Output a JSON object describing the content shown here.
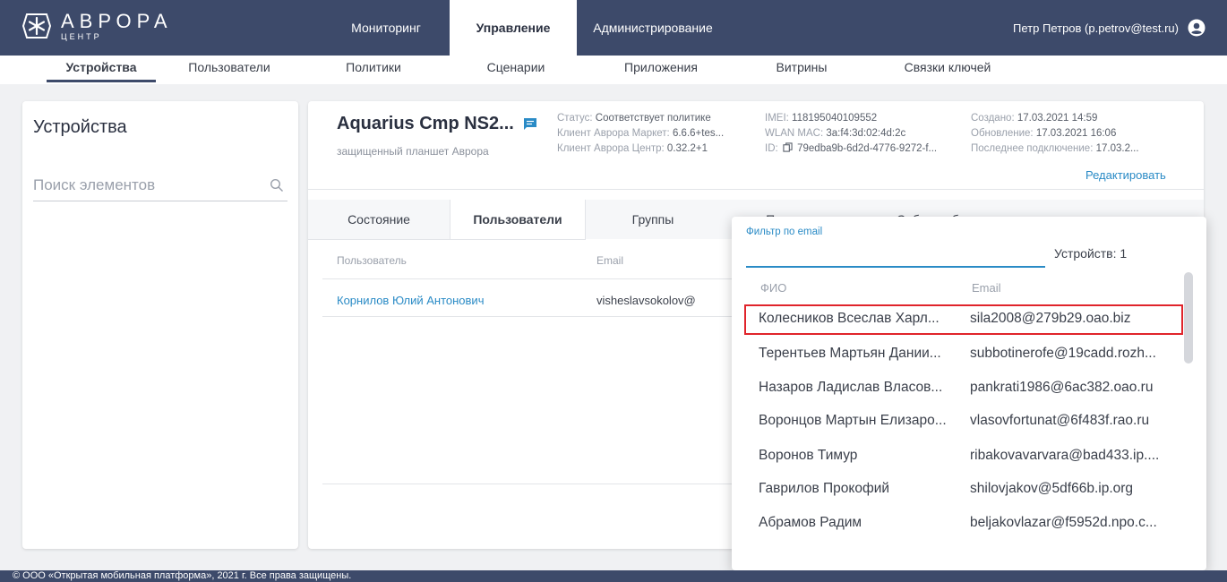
{
  "app": {
    "logo_title": "АВРОРА",
    "logo_sub": "ЦЕНТР"
  },
  "main_nav": [
    "Мониторинг",
    "Управление",
    "Администрирование"
  ],
  "user": {
    "label": "Петр Петров (p.petrov@test.ru)"
  },
  "sub_nav": [
    "Устройства",
    "Пользователи",
    "Политики",
    "Сценарии",
    "Приложения",
    "Витрины",
    "Связки ключей"
  ],
  "left_panel": {
    "title": "Устройства",
    "search_placeholder": "Поиск элементов"
  },
  "device": {
    "name": "Aquarius Cmp NS2...",
    "subtitle": "защищенный планшет Аврора",
    "status_label": "Статус:",
    "status_value": "Соответствует политике",
    "market_label": "Клиент Аврора Маркет:",
    "market_value": "6.6.6+tes...",
    "center_label": "Клиент Аврора Центр:",
    "center_value": "0.32.2+1",
    "imei_label": "IMEI:",
    "imei_value": "118195040109552",
    "wlan_label": "WLAN MAC:",
    "wlan_value": "3a:f4:3d:02:4d:2c",
    "id_label": "ID:",
    "id_value": "79edba9b-6d2d-4776-9272-f...",
    "created_label": "Создано:",
    "created_value": "17.03.2021 14:59",
    "updated_label": "Обновление:",
    "updated_value": "17.03.2021 16:06",
    "last_label": "Последнее подключение:",
    "last_value": "17.03.2...",
    "edit": "Редактировать"
  },
  "tabs": [
    "Состояние",
    "Пользователи",
    "Группы",
    "Политики",
    "События безопасности"
  ],
  "users_table": {
    "col_user": "Пользователь",
    "col_email": "Email",
    "rows": [
      {
        "name": "Корнилов Юлий Антонович",
        "email": "visheslavsokolov@"
      }
    ]
  },
  "popover": {
    "filter_label": "Фильтр по email",
    "count": "Устройств: 1",
    "col_fio": "ФИО",
    "col_email": "Email",
    "rows": [
      {
        "fio": "Колесников Всеслав Харл...",
        "email": "sila2008@279b29.oao.biz"
      },
      {
        "fio": "Терентьев Мартьян Дании...",
        "email": "subbotinerofe@19cadd.rozh..."
      },
      {
        "fio": "Назаров Ладислав Власов...",
        "email": "pankrati1986@6ac382.oao.ru"
      },
      {
        "fio": "Воронцов Мартын Елизаро...",
        "email": "vlasovfortunat@6f483f.rao.ru"
      },
      {
        "fio": "Воронов Тимур",
        "email": "ribakovavarvara@bad433.ip...."
      },
      {
        "fio": "Гаврилов Прокофий",
        "email": "shilovjakov@5df66b.ip.org"
      },
      {
        "fio": "Абрамов Радим",
        "email": "beljakovlazar@f5952d.npo.c..."
      }
    ]
  },
  "footer": "© ООО «Открытая мобильная платформа», 2021 г. Все права защищены."
}
